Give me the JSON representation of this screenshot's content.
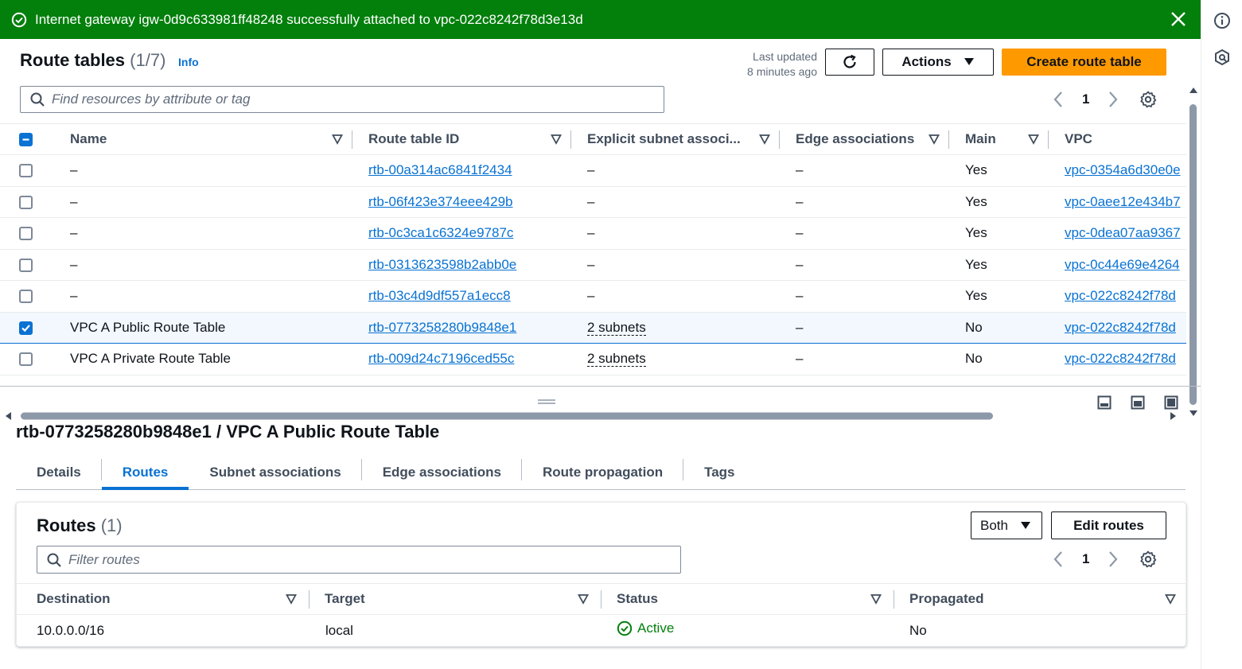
{
  "flash": {
    "message": "Internet gateway igw-0d9c633981ff48248 successfully attached to vpc-022c8242f78d3e13d",
    "color": "#037f0c"
  },
  "header": {
    "title": "Route tables",
    "count": "(1/7)",
    "info": "Info",
    "last_updated": "Last updated",
    "last_updated_ago": "8 minutes ago",
    "actions_label": "Actions",
    "create_label": "Create route table",
    "search_placeholder": "Find resources by attribute or tag",
    "page": "1"
  },
  "table": {
    "columns": [
      "Name",
      "Route table ID",
      "Explicit subnet associ...",
      "Edge associations",
      "Main",
      "VPC"
    ],
    "rows": [
      {
        "selected": false,
        "name": "–",
        "id": "rtb-00a314ac6841f2434",
        "subnets": "–",
        "edge": "–",
        "main": "Yes",
        "vpc": "vpc-0354a6d30e0e"
      },
      {
        "selected": false,
        "name": "–",
        "id": "rtb-06f423e374eee429b",
        "subnets": "–",
        "edge": "–",
        "main": "Yes",
        "vpc": "vpc-0aee12e434b7"
      },
      {
        "selected": false,
        "name": "–",
        "id": "rtb-0c3ca1c6324e9787c",
        "subnets": "–",
        "edge": "–",
        "main": "Yes",
        "vpc": "vpc-0dea07aa9367"
      },
      {
        "selected": false,
        "name": "–",
        "id": "rtb-0313623598b2abb0e",
        "subnets": "–",
        "edge": "–",
        "main": "Yes",
        "vpc": "vpc-0c44e69e4264"
      },
      {
        "selected": false,
        "name": "–",
        "id": "rtb-03c4d9df557a1ecc8",
        "subnets": "–",
        "edge": "–",
        "main": "Yes",
        "vpc": "vpc-022c8242f78d"
      },
      {
        "selected": true,
        "name": "VPC A Public Route Table",
        "id": "rtb-0773258280b9848e1",
        "subnets": "2 subnets",
        "edge": "–",
        "main": "No",
        "vpc": "vpc-022c8242f78d"
      },
      {
        "selected": false,
        "name": "VPC A Private Route Table",
        "id": "rtb-009d24c7196ced55c",
        "subnets": "2 subnets",
        "edge": "–",
        "main": "No",
        "vpc": "vpc-022c8242f78d"
      }
    ]
  },
  "details": {
    "title": "rtb-0773258280b9848e1 / VPC A Public Route Table",
    "tabs": [
      "Details",
      "Routes",
      "Subnet associations",
      "Edge associations",
      "Route propagation",
      "Tags"
    ],
    "active_tab": "Routes"
  },
  "routes": {
    "title": "Routes",
    "count": "(1)",
    "filter_label": "Both",
    "edit_label": "Edit routes",
    "search_placeholder": "Filter routes",
    "page": "1",
    "columns": [
      "Destination",
      "Target",
      "Status",
      "Propagated"
    ],
    "rows": [
      {
        "destination": "10.0.0.0/16",
        "target": "local",
        "status": "Active",
        "propagated": "No"
      }
    ]
  },
  "colors": {
    "link": "#0972d3",
    "primary_button": "#ff9900",
    "success": "#037f0c"
  }
}
